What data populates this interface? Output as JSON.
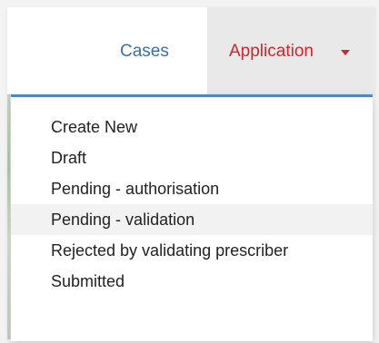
{
  "navbar": {
    "cases_label": "Cases",
    "application_label": "Application"
  },
  "dropdown": {
    "items": [
      {
        "label": "Create New"
      },
      {
        "label": "Draft"
      },
      {
        "label": "Pending - authorisation"
      },
      {
        "label": "Pending - validation"
      },
      {
        "label": "Rejected by validating prescriber"
      },
      {
        "label": "Submitted"
      }
    ],
    "hovered_index": 3
  },
  "colors": {
    "link_blue": "#3b6ea8",
    "active_red": "#d0262a",
    "accent_border": "#4f86c6",
    "hover_bg": "#f2f2f2"
  },
  "icons": {
    "application_toggle": "caret-down-icon"
  }
}
